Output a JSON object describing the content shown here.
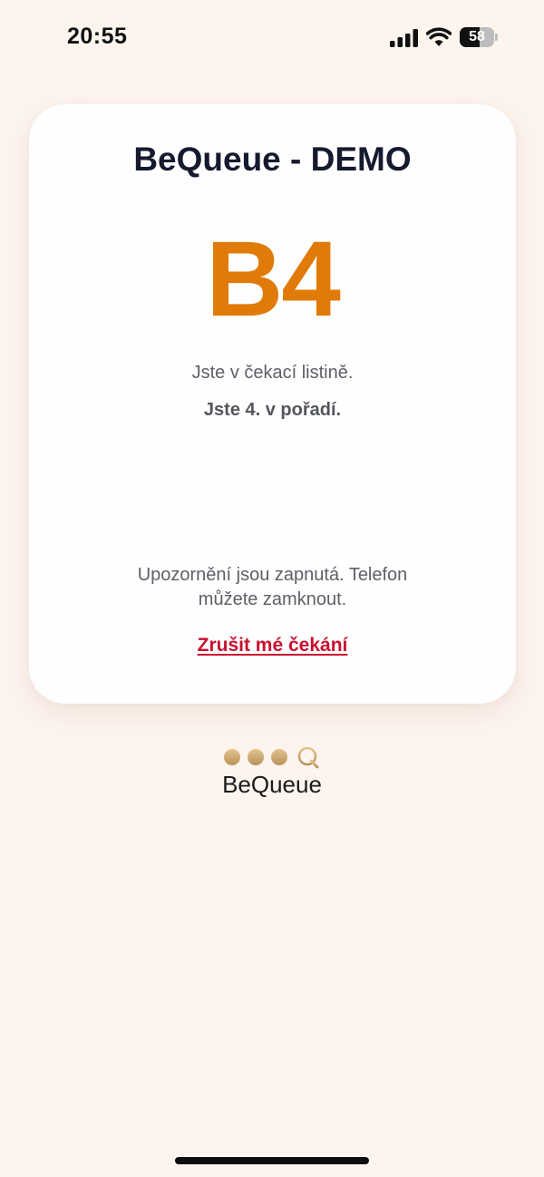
{
  "status_bar": {
    "time": "20:55",
    "battery_level": "58",
    "battery_fraction": 0.58
  },
  "card": {
    "title": "BeQueue - DEMO",
    "ticket_number": "B4",
    "waitlist_text": "Jste v čekací listině.",
    "position_text": "Jste 4. v pořadí.",
    "notification_text": "Upozornění jsou zapnutá. Telefon můžete zamknout.",
    "cancel_label": "Zrušit mé čekání"
  },
  "brand": {
    "name": "BeQueue"
  },
  "colors": {
    "background": "#fdf4ee",
    "accent_orange": "#e07b0a",
    "cancel_red": "#c8102e",
    "title_navy": "#161a2e",
    "brand_gold": "#c9a46a"
  },
  "icons": [
    "signal-icon",
    "wifi-icon",
    "battery-icon",
    "bequeue-logo-icon"
  ]
}
